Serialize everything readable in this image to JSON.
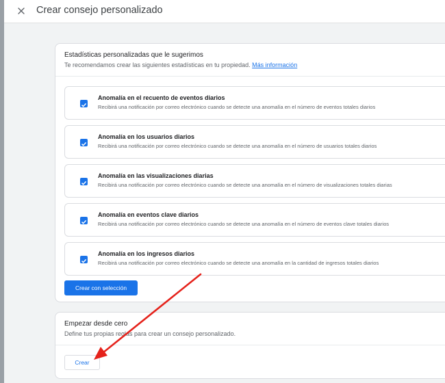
{
  "header": {
    "title": "Crear consejo personalizado",
    "close_icon": "close-icon"
  },
  "suggested": {
    "title": "Estadísticas personalizadas que le sugerimos",
    "subtitle": "Te recomendamos crear las siguientes estadísticas en tu propiedad.",
    "link": "Más información",
    "items": [
      {
        "title": "Anomalía en el recuento de eventos diarios",
        "description": "Recibirá una notificación por correo electrónico cuando se detecte una anomalía en el número de eventos totales diarios",
        "checked": true
      },
      {
        "title": "Anomalía en los usuarios diarios",
        "description": "Recibirá una notificación por correo electrónico cuando se detecte una anomalía en el número de usuarios totales diarios",
        "checked": true
      },
      {
        "title": "Anomalía en las visualizaciones diarias",
        "description": "Recibirá una notificación por correo electrónico cuando se detecte una anomalía en el número de visualizaciones totales diarias",
        "checked": true
      },
      {
        "title": "Anomalía en eventos clave diarios",
        "description": "Recibirá una notificación por correo electrónico cuando se detecte una anomalía en el número de eventos clave totales diarios",
        "checked": true
      },
      {
        "title": "Anomalía en los ingresos diarios",
        "description": "Recibirá una notificación por correo electrónico cuando se detecte una anomalía en la cantidad de ingresos totales diarios",
        "checked": true
      }
    ],
    "button": "Crear con selección"
  },
  "scratch": {
    "title": "Empezar desde cero",
    "subtitle": "Define tus propias reglas para crear un consejo personalizado.",
    "button": "Crear"
  },
  "colors": {
    "accent": "#1a73e8",
    "annotation_arrow": "#e5221b"
  },
  "annotation": {
    "type": "arrow",
    "points_to": "create-button"
  }
}
